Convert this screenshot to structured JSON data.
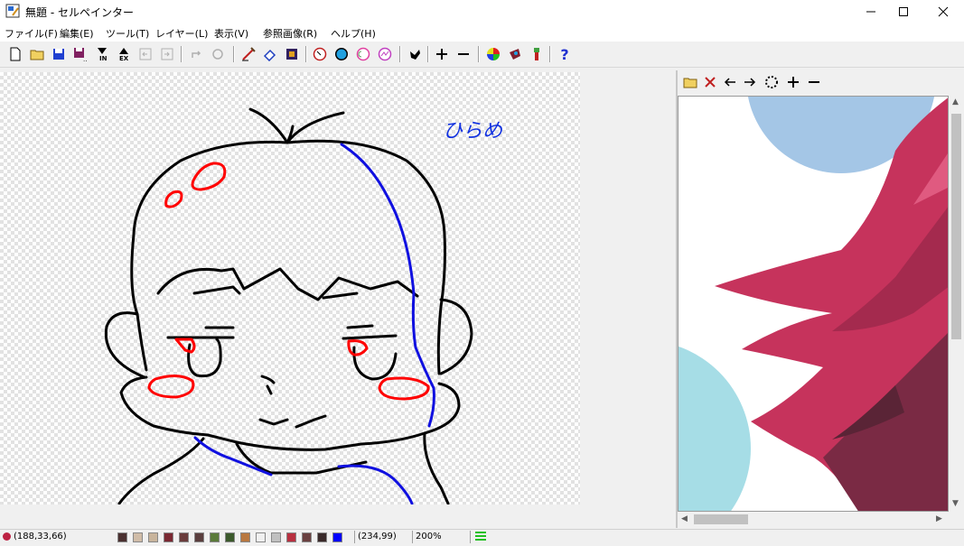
{
  "window": {
    "title": "無題 - セルペインター"
  },
  "menu": [
    "ファイル(F)",
    "編集(E)",
    "ツール(T)",
    "レイヤー(L)",
    "表示(V)",
    "参照画像(R)",
    "ヘルプ(H)"
  ],
  "toolbar": {
    "help_label": "?"
  },
  "canvas": {
    "drawn_text": "ひらめ"
  },
  "status": {
    "color_value": "(188,33,66)",
    "cursor_pos": "(234,99)",
    "zoom": "200%"
  },
  "palette": [
    "#4a3030",
    "#d0bca8",
    "#c8b49c",
    "#7a2832",
    "#6a3c3c",
    "#5a3e3e",
    "#5a7a3a",
    "#3c5a2c",
    "#b87840",
    "#f0f0f0",
    "#c0c0c0",
    "#b83040",
    "#6a4040",
    "#3a2a2a",
    "#0000ff"
  ],
  "colors": {
    "current": "#bc2142",
    "sketch_black": "#000000",
    "sketch_red": "#ff0000",
    "sketch_blue": "#0000ff"
  }
}
